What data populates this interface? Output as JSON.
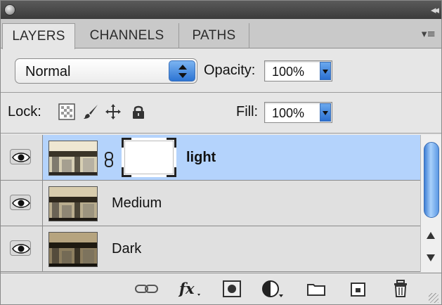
{
  "tabs": [
    {
      "label": "LAYERS"
    },
    {
      "label": "CHANNELS"
    },
    {
      "label": "PATHS"
    }
  ],
  "blend_mode": {
    "value": "Normal"
  },
  "opacity": {
    "label": "Opacity:",
    "value": "100%"
  },
  "lock": {
    "label": "Lock:"
  },
  "fill": {
    "label": "Fill:",
    "value": "100%"
  },
  "layers": [
    {
      "name": "light",
      "selected": true,
      "has_mask": true
    },
    {
      "name": "Medium",
      "selected": false,
      "has_mask": false
    },
    {
      "name": "Dark",
      "selected": false,
      "has_mask": false
    }
  ],
  "icons": {
    "titlebar": [
      "close-icon",
      "collapse-icon"
    ],
    "panel_menu": "panel-menu-icon",
    "lock": [
      "lock-transparent-icon",
      "lock-image-icon",
      "lock-position-icon",
      "lock-all-icon"
    ],
    "bottom": [
      "link-layers-icon",
      "layer-style-icon",
      "add-mask-icon",
      "adjustment-layer-icon",
      "new-group-icon",
      "new-layer-icon",
      "delete-layer-icon"
    ]
  },
  "colors": {
    "selection": "#b4d3fc",
    "accent": "#2d74d3"
  }
}
